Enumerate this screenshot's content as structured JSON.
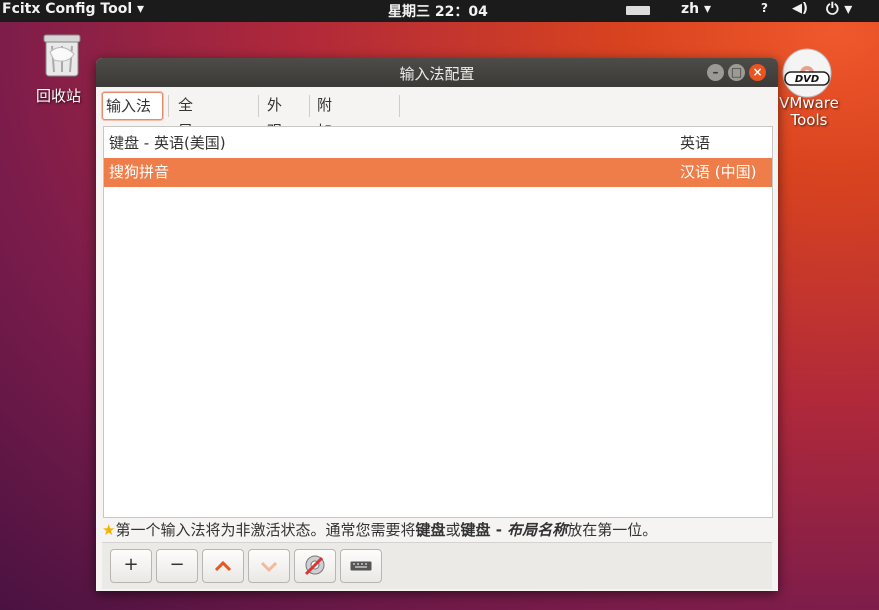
{
  "topbar": {
    "app_title": "Fcitx Config Tool ▾",
    "clock": "星期三 22：04",
    "lang": "zh ▾",
    "net": "?",
    "volume": "◀)",
    "power": "⏻ ▾"
  },
  "desktop": {
    "trash_label": "回收站",
    "dvd_label": "VMware Tools",
    "dvd_badge": "DVD"
  },
  "window": {
    "title": "输入法配置",
    "tabs": [
      "输入法",
      "全局配置",
      "外观",
      "附加组件"
    ],
    "rows": [
      {
        "name": "键盘 - 英语(美国)",
        "lang": "英语"
      },
      {
        "name": "搜狗拼音",
        "lang": "汉语 (中国)"
      }
    ],
    "hint": {
      "star": "★",
      "part1": "第一个输入法将为非激活状态。通常您需要将",
      "bold1": "键盘",
      "part2": "或",
      "bold2": "键盘 - ",
      "italic": "布局名称",
      "part3": "放在第一位。"
    },
    "buttons": {
      "add": "+",
      "remove": "−",
      "up": "︿",
      "down": "﹀"
    }
  },
  "colors": {
    "accent": "#e95420",
    "selection": "#ef7d4a"
  }
}
